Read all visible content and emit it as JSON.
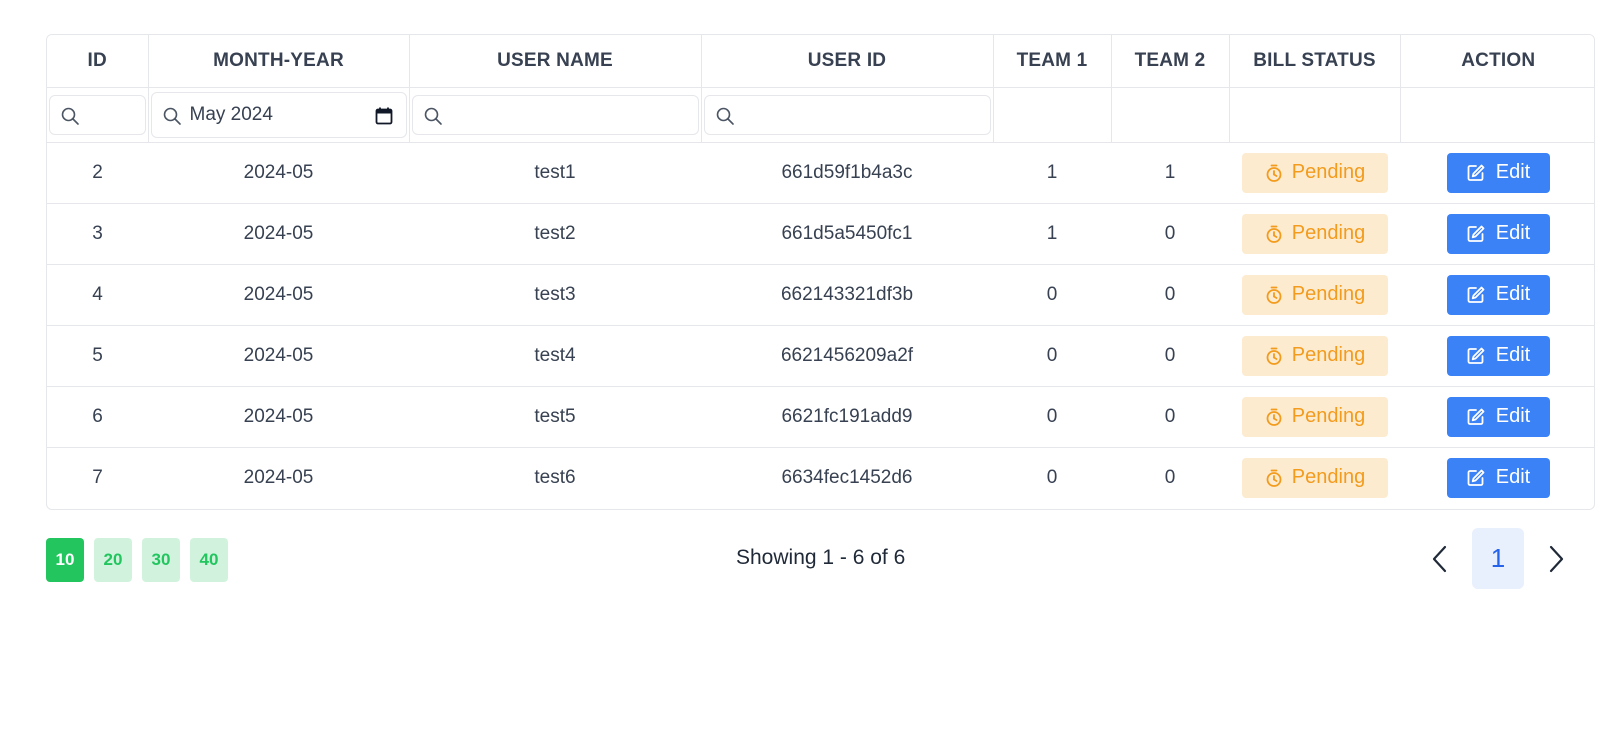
{
  "table": {
    "headers": [
      "ID",
      "MONTH-YEAR",
      "USER NAME",
      "USER ID",
      "TEAM 1",
      "TEAM 2",
      "BILL STATUS",
      "ACTION"
    ],
    "filters": {
      "id_value": "",
      "month_value": "May 2024",
      "username_value": "",
      "userid_value": ""
    },
    "rows": [
      {
        "id": "2",
        "month": "2024-05",
        "username": "test1",
        "userid": "661d59f1b4a3c",
        "team1": "1",
        "team2": "1",
        "status": "Pending",
        "action": "Edit"
      },
      {
        "id": "3",
        "month": "2024-05",
        "username": "test2",
        "userid": "661d5a5450fc1",
        "team1": "1",
        "team2": "0",
        "status": "Pending",
        "action": "Edit"
      },
      {
        "id": "4",
        "month": "2024-05",
        "username": "test3",
        "userid": "662143321df3b",
        "team1": "0",
        "team2": "0",
        "status": "Pending",
        "action": "Edit"
      },
      {
        "id": "5",
        "month": "2024-05",
        "username": "test4",
        "userid": "6621456209a2f",
        "team1": "0",
        "team2": "0",
        "status": "Pending",
        "action": "Edit"
      },
      {
        "id": "6",
        "month": "2024-05",
        "username": "test5",
        "userid": "6621fc191add9",
        "team1": "0",
        "team2": "0",
        "status": "Pending",
        "action": "Edit"
      },
      {
        "id": "7",
        "month": "2024-05",
        "username": "test6",
        "userid": "6634fec1452d6",
        "team1": "0",
        "team2": "0",
        "status": "Pending",
        "action": "Edit"
      }
    ]
  },
  "pagination": {
    "page_sizes": [
      "10",
      "20",
      "30",
      "40"
    ],
    "active_page_size": "10",
    "showing_text": "Showing 1 - 6 of 6",
    "current_page": "1"
  },
  "colors": {
    "pending_bg": "#fdebd0",
    "pending_text": "#f29b1d",
    "edit_bg": "#3b82f6",
    "size_active": "#22c55e",
    "size_inactive_bg": "#d1f3de",
    "page_bg": "#e8effd"
  },
  "icons": {
    "filter": "search-icon",
    "month_picker": "calendar-icon",
    "status": "stopwatch-icon",
    "action": "edit-icon",
    "prev": "chevron-left-icon",
    "next": "chevron-right-icon"
  }
}
